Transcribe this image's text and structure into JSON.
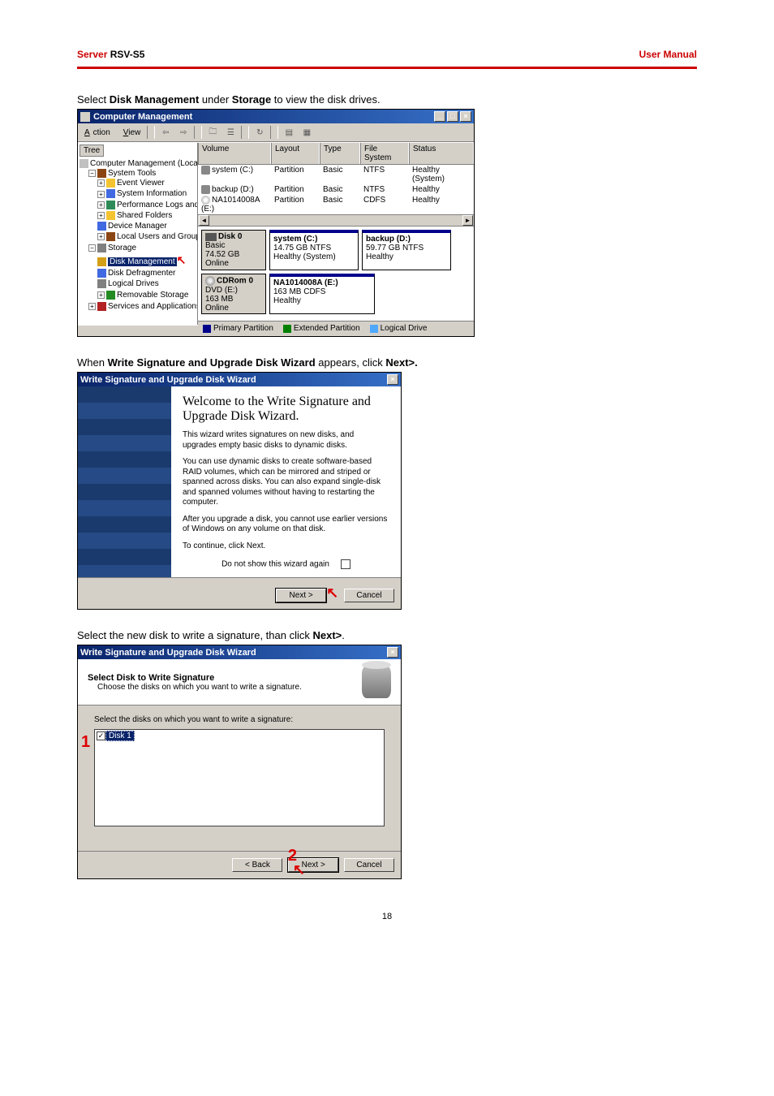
{
  "header": {
    "brand": "Server",
    "model": " RSV-S5",
    "right": "User Manual"
  },
  "instr1_pre": "Select ",
  "instr1_b1": "Disk Management",
  "instr1_mid": " under ",
  "instr1_b2": "Storage",
  "instr1_post": " to view the disk drives.",
  "cm": {
    "title": "Computer Management",
    "menu_action": "Action",
    "menu_view": "View",
    "btn_min": "_",
    "btn_max": "□",
    "btn_close": "×",
    "tree_label": "Tree",
    "tree": {
      "root": "Computer Management (Local)",
      "systools": "System Tools",
      "event": "Event Viewer",
      "sysinfo": "System Information",
      "perf": "Performance Logs and Alerts",
      "shared": "Shared Folders",
      "device": "Device Manager",
      "users": "Local Users and Groups",
      "storage": "Storage",
      "diskmgmt": "Disk Management",
      "defrag": "Disk Defragmenter",
      "logical": "Logical Drives",
      "remov": "Removable Storage",
      "services": "Services and Applications"
    },
    "cols": {
      "vol": "Volume",
      "layout": "Layout",
      "type": "Type",
      "fs": "File System",
      "status": "Status"
    },
    "rows": [
      {
        "vol": "system (C:)",
        "layout": "Partition",
        "type": "Basic",
        "fs": "NTFS",
        "status": "Healthy (System)"
      },
      {
        "vol": "backup (D:)",
        "layout": "Partition",
        "type": "Basic",
        "fs": "NTFS",
        "status": "Healthy"
      },
      {
        "vol": "NA1014008A (E:)",
        "layout": "Partition",
        "type": "Basic",
        "fs": "CDFS",
        "status": "Healthy"
      }
    ],
    "disk0": {
      "name": "Disk 0",
      "type": "Basic",
      "size": "74.52 GB",
      "state": "Online",
      "p1": {
        "name": "system  (C:)",
        "size": "14.75 GB NTFS",
        "state": "Healthy (System)"
      },
      "p2": {
        "name": "backup  (D:)",
        "size": "59.77 GB NTFS",
        "state": "Healthy"
      }
    },
    "cdrom": {
      "name": "CDRom 0",
      "type": "DVD (E:)",
      "size": "163 MB",
      "state": "Online",
      "p1": {
        "name": "NA1014008A  (E:)",
        "size": "163 MB CDFS",
        "state": "Healthy"
      }
    },
    "legend": {
      "pp": "Primary Partition",
      "ep": "Extended Partition",
      "ld": "Logical Drive"
    }
  },
  "instr2_pre": "When ",
  "instr2_b": "Write Signature and Upgrade Disk Wizard",
  "instr2_post": " appears, click ",
  "instr2_b2": "Next>.",
  "wiz1": {
    "title": "Write Signature and Upgrade Disk Wizard",
    "close": "×",
    "h": "Welcome to the Write Signature and Upgrade Disk Wizard.",
    "p1": "This wizard writes signatures on new disks, and upgrades empty basic disks to dynamic disks.",
    "p2": "You can use dynamic disks to create software-based RAID volumes, which can be mirrored and striped or spanned across disks. You can also expand single-disk and spanned volumes without having to restarting the computer.",
    "p3": "After you upgrade a disk, you cannot use earlier versions of Windows on any volume on that disk.",
    "p4": "To continue, click Next.",
    "chk": "Do not show this wizard again",
    "next": "Next >",
    "cancel": "Cancel"
  },
  "instr3_pre": "Select the new disk to write a signature, than click ",
  "instr3_b": "Next>",
  "instr3_post": ".",
  "wiz2": {
    "title": "Write Signature and Upgrade Disk Wizard",
    "close": "×",
    "head_b": "Select Disk to Write Signature",
    "head_s": "Choose the disks on which you want to write a signature.",
    "prompt": "Select the disks on which you want to write a signature:",
    "item": "Disk 1",
    "check": "✓",
    "back": "< Back",
    "next": "Next >",
    "cancel": "Cancel",
    "ann1": "1",
    "ann2": "2"
  },
  "pgnum": "18"
}
